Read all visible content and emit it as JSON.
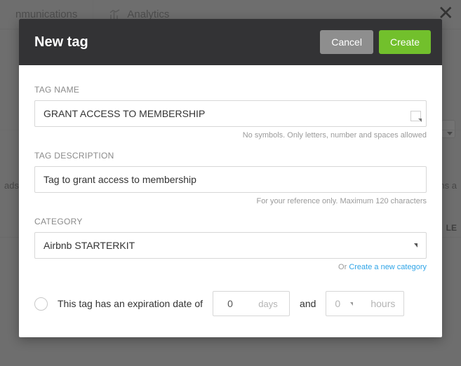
{
  "background": {
    "tab1": "nmunications",
    "tab2": "Analytics",
    "left_strip": "ads. F",
    "right_strip": "ons a",
    "le_label": "LE",
    "close_glyph": "✕"
  },
  "modal": {
    "title": "New tag",
    "cancel_label": "Cancel",
    "create_label": "Create",
    "tag_name": {
      "label": "TAG NAME",
      "value": "GRANT ACCESS TO MEMBERSHIP",
      "hint": "No symbols. Only letters, number and spaces allowed"
    },
    "tag_description": {
      "label": "TAG DESCRIPTION",
      "value": "Tag to grant access to membership",
      "hint": "For your reference only. Maximum 120 characters"
    },
    "category": {
      "label": "CATEGORY",
      "value": "Airbnb STARTERKIT",
      "or": "Or ",
      "create_link": "Create a new category"
    },
    "expiration": {
      "text": "This tag has an expiration date of",
      "days_value": "0",
      "days_unit": "days",
      "and": "and",
      "hours_value": "0",
      "hours_unit": "hours"
    }
  }
}
